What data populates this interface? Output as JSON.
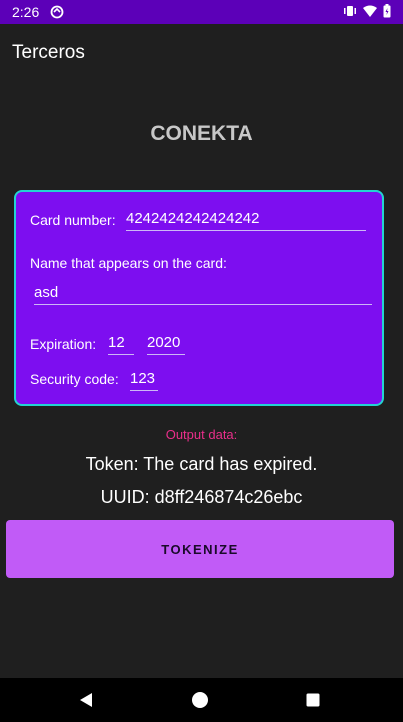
{
  "status_bar": {
    "time": "2:26",
    "icons": [
      "sync-icon",
      "vibrate-icon",
      "wifi-icon",
      "battery-icon"
    ]
  },
  "app": {
    "title": "Terceros"
  },
  "brand": "CONEKTA",
  "form": {
    "card_number_label": "Card number:",
    "card_number_value": "4242424242424242",
    "name_label": "Name that appears on the card:",
    "name_value": "asd",
    "expiration_label": "Expiration:",
    "exp_month": "12",
    "exp_year": "2020",
    "security_label": "Security code:",
    "security_value": "123"
  },
  "output": {
    "label": "Output data:",
    "token": "Token: The card has expired.",
    "uuid": "UUID: d8ff246874c26ebc"
  },
  "button": {
    "tokenize_label": "TOKENIZE"
  },
  "colors": {
    "status_bar": "#5c00b8",
    "background": "#1f1f1f",
    "card": "#7d0ef0",
    "card_border": "#23d4d1",
    "button": "#c15bf7",
    "output_label": "#ea2f8b"
  }
}
